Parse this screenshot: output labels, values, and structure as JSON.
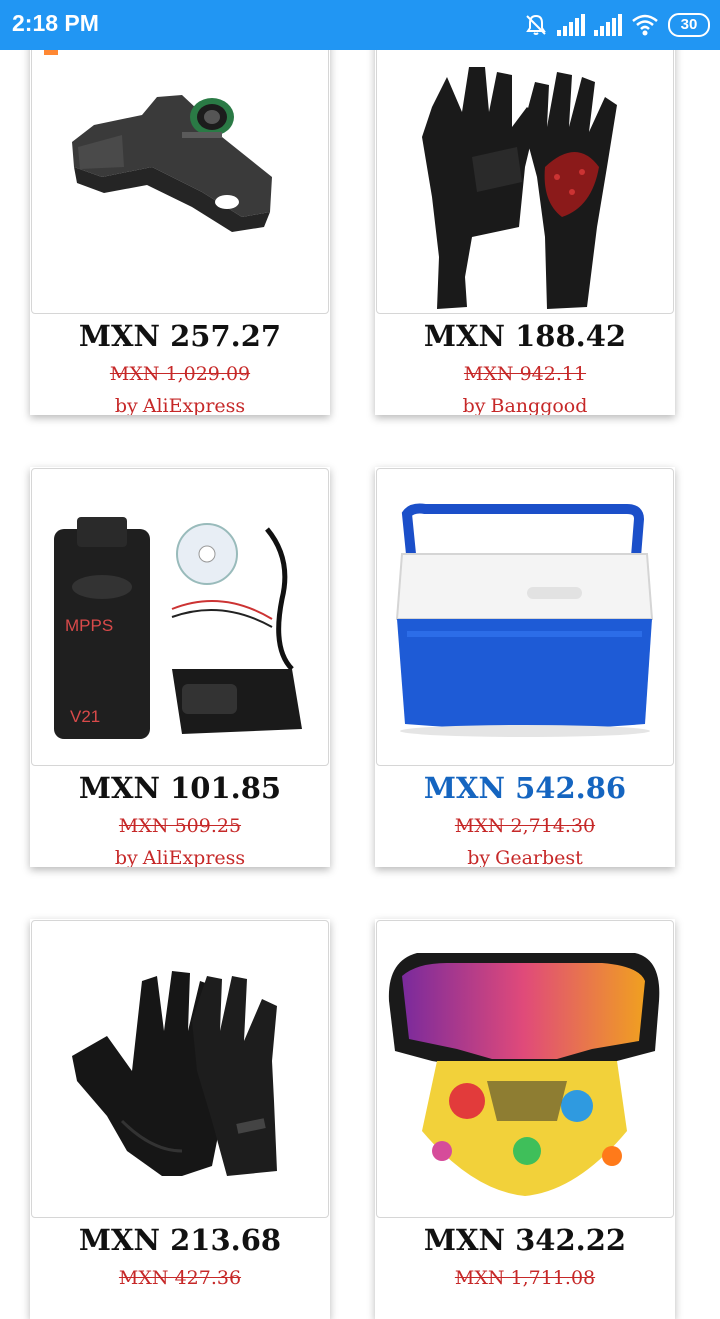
{
  "status_bar": {
    "time": "2:18 PM",
    "battery": "30"
  },
  "labels": {
    "by": "by"
  },
  "products": [
    {
      "price": "MXN 257.27",
      "old_price": "MXN 1,029.09",
      "store": "AliExpress",
      "icon": "map-sensor-image",
      "highlight": false
    },
    {
      "price": "MXN 188.42",
      "old_price": "MXN 942.11",
      "store": "Banggood",
      "icon": "touchscreen-gloves-image",
      "highlight": false
    },
    {
      "price": "MXN 101.85",
      "old_price": "MXN 509.25",
      "store": "AliExpress",
      "icon": "obd-diagnostic-kit-image",
      "highlight": false
    },
    {
      "price": "MXN 542.86",
      "old_price": "MXN 2,714.30",
      "store": "Gearbest",
      "icon": "cooler-box-image",
      "highlight": true
    },
    {
      "price": "MXN 213.68",
      "old_price": "MXN 427.36",
      "store": "",
      "icon": "black-gloves-image",
      "highlight": false
    },
    {
      "price": "MXN 342.22",
      "old_price": "MXN 1,711.08",
      "store": "",
      "icon": "goggles-mask-image",
      "highlight": false
    }
  ],
  "overlay_texts": {
    "mpps": "MPPS",
    "v21": "V21"
  },
  "colors": {
    "status_bar": "#2196F3",
    "price_highlight": "#1565C0",
    "discount_red": "#C62828"
  }
}
